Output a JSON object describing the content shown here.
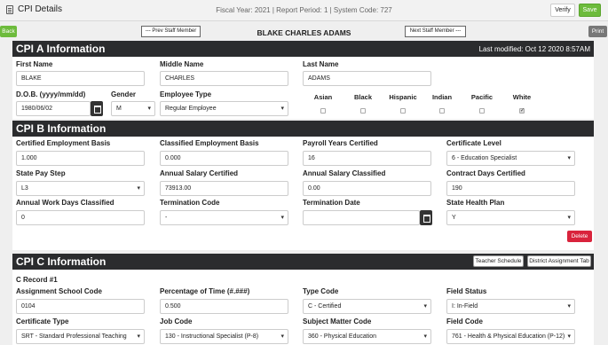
{
  "header": {
    "title": "CPI Details",
    "info": "Fiscal Year: 2021 | Report Period: 1 | System Code: 727",
    "verify": "Verify",
    "save": "Save"
  },
  "nav": {
    "back": "Back",
    "prev": "--- Prev Staff Member",
    "staff_name": "BLAKE CHARLES ADAMS",
    "next": "Next Staff Member ---",
    "print": "Print"
  },
  "cpi_a": {
    "title": "CPI A Information",
    "modified": "Last modified: Oct 12 2020 8:57AM",
    "first_name_label": "First Name",
    "first_name": "BLAKE",
    "middle_name_label": "Middle Name",
    "middle_name": "CHARLES",
    "last_name_label": "Last Name",
    "last_name": "ADAMS",
    "dob_label": "D.O.B. (yyyy/mm/dd)",
    "dob": "1980/06/02",
    "gender_label": "Gender",
    "gender": "M",
    "emp_type_label": "Employee Type",
    "emp_type": "Regular Employee",
    "races": [
      {
        "label": "Asian",
        "checked": false
      },
      {
        "label": "Black",
        "checked": false
      },
      {
        "label": "Hispanic",
        "checked": false
      },
      {
        "label": "Indian",
        "checked": false
      },
      {
        "label": "Pacific",
        "checked": false
      },
      {
        "label": "White",
        "checked": true
      }
    ]
  },
  "cpi_b": {
    "title": "CPI B Information",
    "cert_basis_label": "Certified Employment Basis",
    "cert_basis": "1.000",
    "class_basis_label": "Classified Employment Basis",
    "class_basis": "0.000",
    "payroll_years_label": "Payroll Years Certified",
    "payroll_years": "16",
    "cert_level_label": "Certificate Level",
    "cert_level": "6 - Education Specialist",
    "pay_step_label": "State Pay Step",
    "pay_step": "L3",
    "salary_cert_label": "Annual Salary Certified",
    "salary_cert": "73913.00",
    "salary_class_label": "Annual Salary Classified",
    "salary_class": "0.00",
    "contract_days_label": "Contract Days Certified",
    "contract_days": "190",
    "work_days_label": "Annual Work Days Classified",
    "work_days": "0",
    "term_code_label": "Termination Code",
    "term_code": "-",
    "term_date_label": "Termination Date",
    "term_date": "",
    "health_plan_label": "State Health Plan",
    "health_plan": "Y",
    "delete": "Delete"
  },
  "cpi_c": {
    "title": "CPI C Information",
    "teacher_schedule": "Teacher Schedule",
    "district_tab": "District Assignment Tab",
    "record": "C Record #1",
    "school_code_label": "Assignment School Code",
    "school_code": "0104",
    "pct_time_label": "Percentage of Time (#.###)",
    "pct_time": "0.500",
    "type_code_label": "Type Code",
    "type_code": "C - Certified",
    "field_status_label": "Field Status",
    "field_status": "I: In-Field",
    "cert_type_label": "Certificate Type",
    "cert_type": "SRT - Standard Professional Teaching",
    "job_code_label": "Job Code",
    "job_code": "130 - Instructional Specialist (P-8)",
    "subject_code_label": "Subject Matter Code",
    "subject_code": "360 - Physical Education",
    "field_code_label": "Field Code",
    "field_code": "761 - Health & Physical Education (P-12)"
  }
}
